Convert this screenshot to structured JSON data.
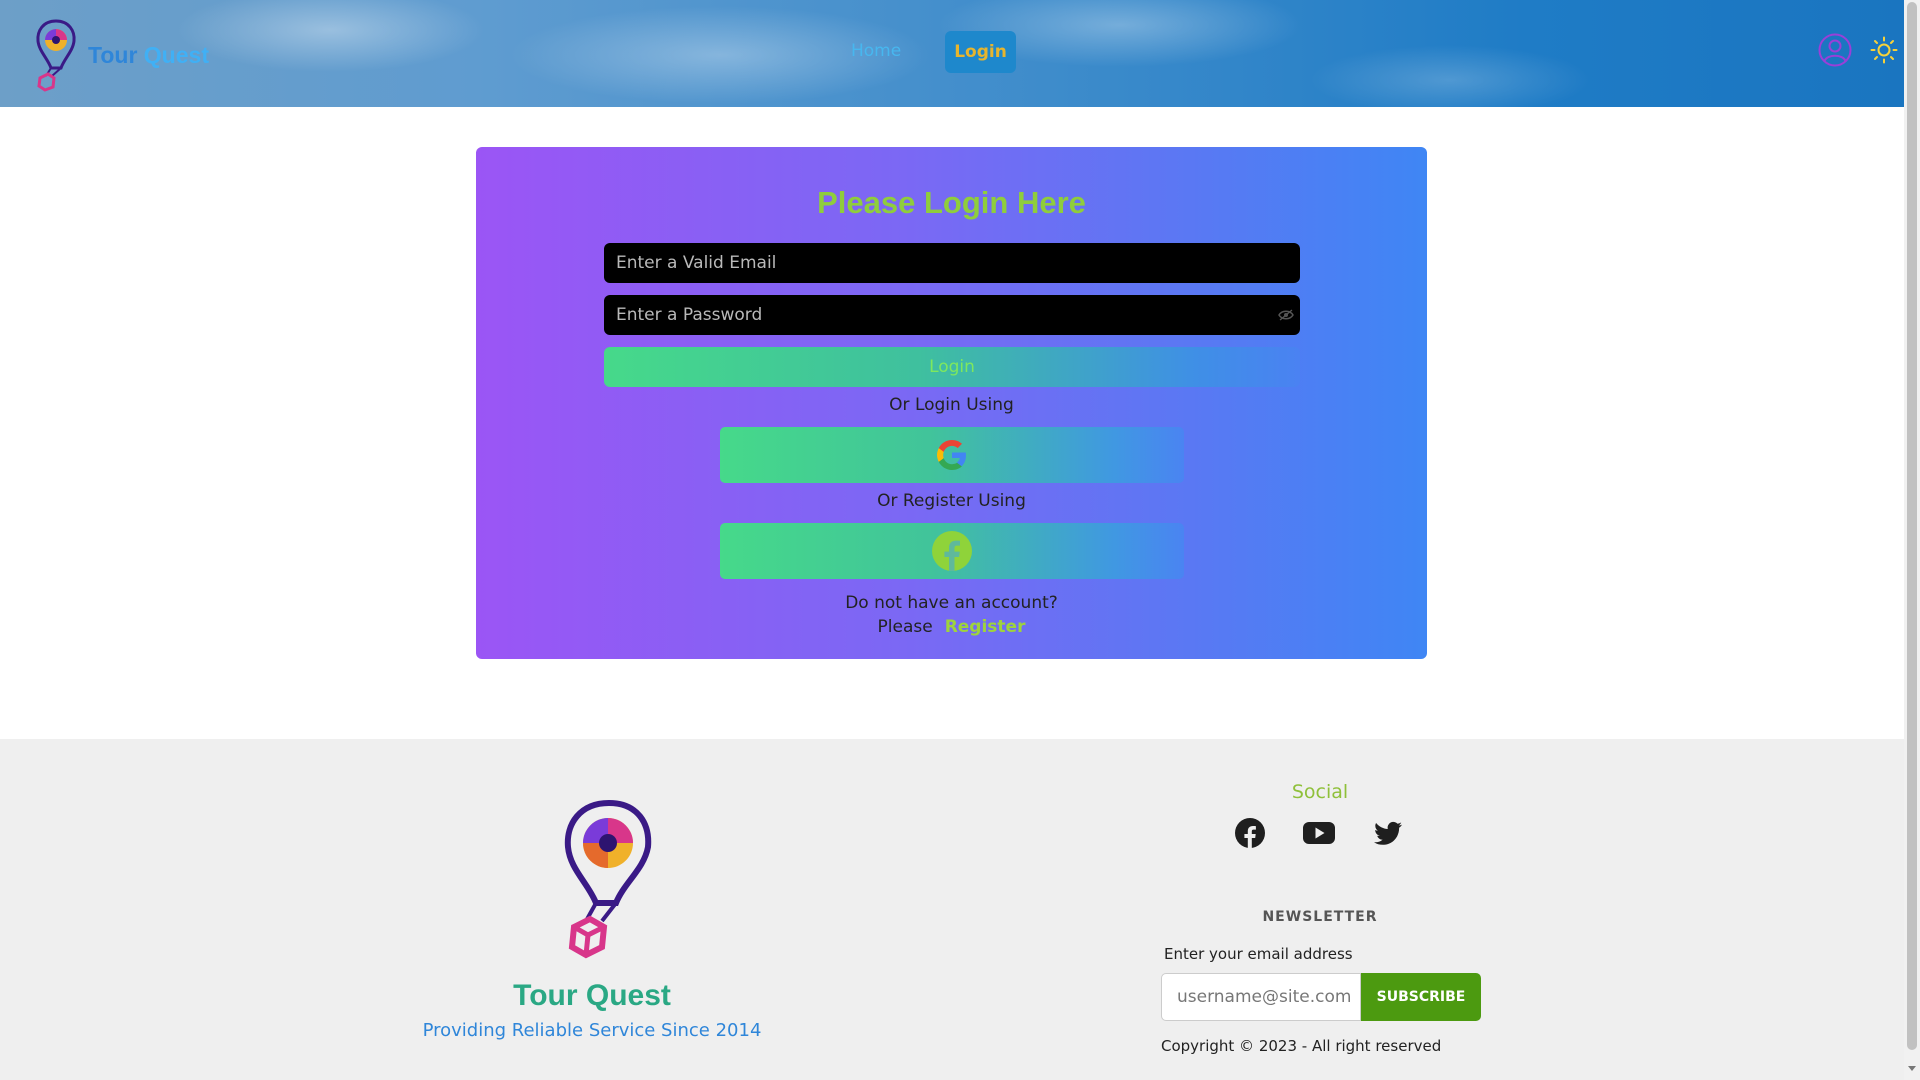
{
  "header": {
    "brand": {
      "word1": "Tour",
      "word2": "Quest"
    },
    "nav": {
      "home": "Home",
      "login": "Login"
    },
    "icons": [
      "balloon-logo",
      "user-icon",
      "sun-icon"
    ]
  },
  "login": {
    "title": "Please Login Here",
    "email_placeholder": "Enter a Valid Email",
    "password_placeholder": "Enter a Password",
    "login_button": "Login",
    "or_login": "Or Login Using",
    "or_register": "Or Register Using",
    "no_account": "Do not have an account?",
    "please": "Please",
    "register_link": "Register",
    "social_icons": [
      "google-icon",
      "facebook-icon"
    ]
  },
  "footer": {
    "brand": "Tour Quest",
    "tagline": "Providing Reliable Service Since 2014",
    "social_title": "Social",
    "social_icons": [
      "facebook-icon",
      "youtube-icon",
      "twitter-icon"
    ],
    "newsletter_title": "NEWSLETTER",
    "newsletter_label": "Enter your email address",
    "newsletter_placeholder": "username@site.com",
    "subscribe": "SUBSCRIBE",
    "copyright": "Copyright © 2023 - All right reserved"
  },
  "colors": {
    "accent_green": "#8fcd3c",
    "subscribe_green": "#4c9a10",
    "card_gradient_start": "#9b55f5",
    "card_gradient_end": "#3f86f4",
    "nav_button": "#1e88cc"
  }
}
